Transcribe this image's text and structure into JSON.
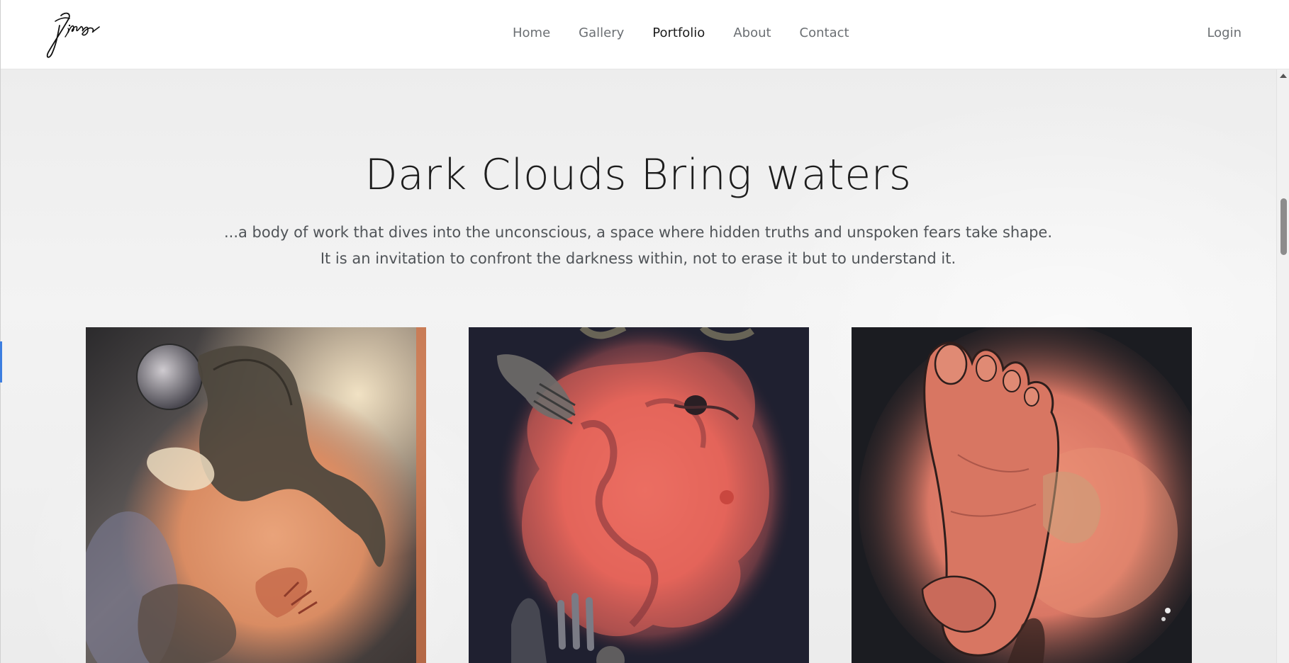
{
  "header": {
    "logo_text": "Jienga",
    "nav": [
      {
        "label": "Home",
        "active": false
      },
      {
        "label": "Gallery",
        "active": false
      },
      {
        "label": "Portfolio",
        "active": true
      },
      {
        "label": "About",
        "active": false
      },
      {
        "label": "Contact",
        "active": false
      }
    ],
    "login_label": "Login"
  },
  "hero": {
    "title": "Dark Clouds Bring waters",
    "subtitle_line1": "...a body of work that dives into the unconscious, a space where hidden truths and unspoken fears take shape.",
    "subtitle_line2": "It is an invitation to confront the darkness within, not to erase it but to understand it."
  },
  "gallery": {
    "artworks": [
      {
        "subject": "horse-and-moon-painting"
      },
      {
        "subject": "red-cloud-figures-painting"
      },
      {
        "subject": "foot-painting"
      }
    ]
  },
  "colors": {
    "accent": "#3d7ee0",
    "nav_active": "#1c1c1c",
    "nav_inactive": "#6b6f73"
  }
}
